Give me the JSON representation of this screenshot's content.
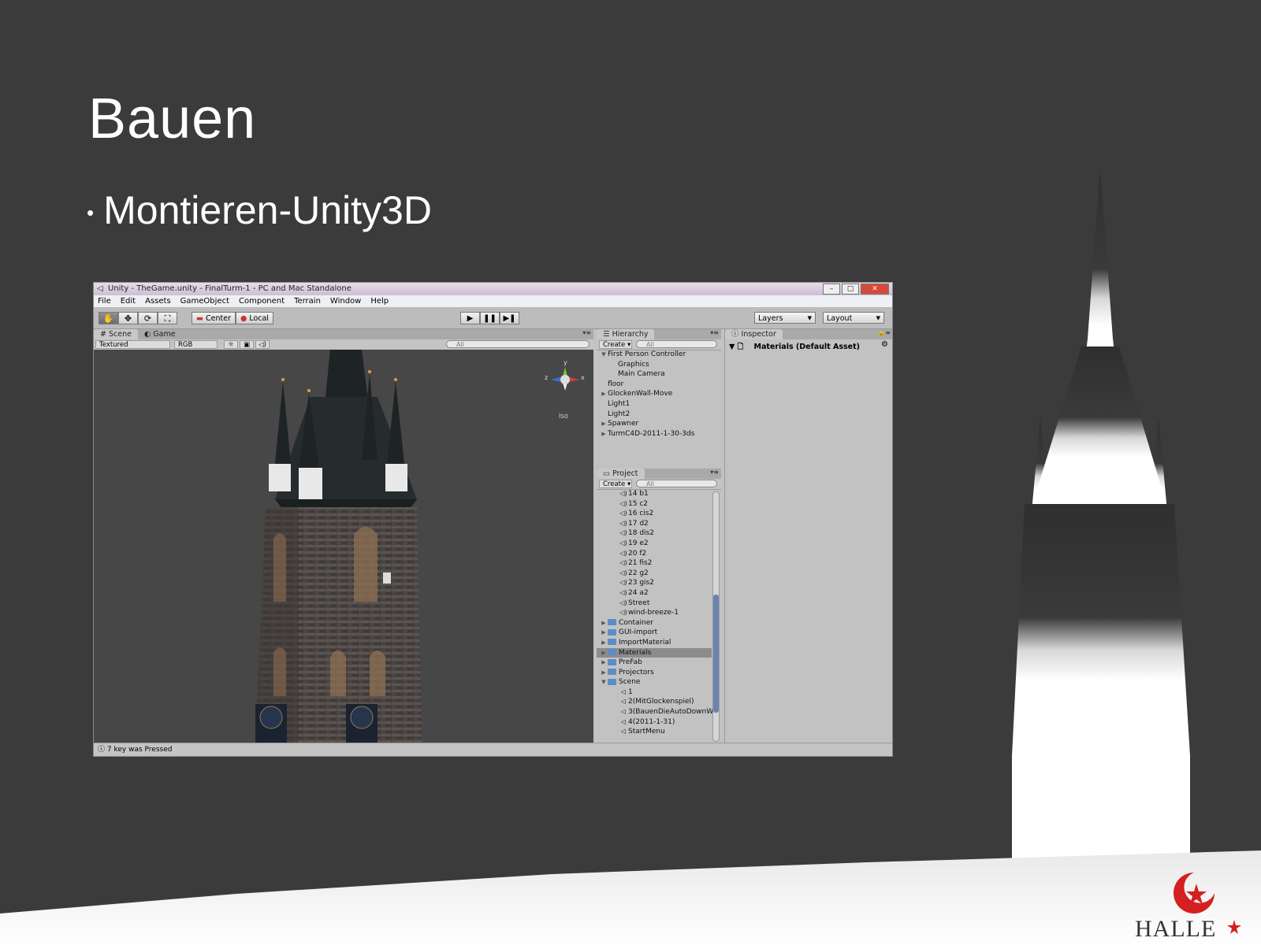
{
  "slide": {
    "title": "Bauen",
    "bullet": "Montieren-Unity3D",
    "logo_text": "HALLE"
  },
  "window": {
    "title": "Unity - TheGame.unity - FinalTurm-1 - PC and Mac Standalone",
    "menu": [
      "File",
      "Edit",
      "Assets",
      "GameObject",
      "Component",
      "Terrain",
      "Window",
      "Help"
    ],
    "toolbar": {
      "pivot_center": "Center",
      "pivot_local": "Local",
      "layers": "Layers",
      "layout": "Layout"
    },
    "scene": {
      "tab_scene": "Scene",
      "tab_game": "Game",
      "render_mode": "Textured",
      "color_mode": "RGB",
      "search_placeholder": "All",
      "gizmo_label": "Iso"
    },
    "hierarchy": {
      "tab": "Hierarchy",
      "create": "Create",
      "search_placeholder": "All",
      "items": [
        {
          "label": "First Person Controller",
          "expanded": true,
          "indent": 0
        },
        {
          "label": "Graphics",
          "indent": 1
        },
        {
          "label": "Main Camera",
          "indent": 1
        },
        {
          "label": "floor",
          "indent": 0
        },
        {
          "label": "GlockenWall-Move",
          "collapsed": true,
          "indent": 0
        },
        {
          "label": "Light1",
          "indent": 0
        },
        {
          "label": "Light2",
          "indent": 0
        },
        {
          "label": "Spawner",
          "collapsed": true,
          "indent": 0
        },
        {
          "label": "TurmC4D-2011-1-30-3ds",
          "collapsed": true,
          "indent": 0
        }
      ]
    },
    "project": {
      "tab": "Project",
      "create": "Create",
      "search_placeholder": "All",
      "items": [
        {
          "label": "14 b1",
          "type": "audio"
        },
        {
          "label": "15 c2",
          "type": "audio"
        },
        {
          "label": "16 cis2",
          "type": "audio"
        },
        {
          "label": "17 d2",
          "type": "audio"
        },
        {
          "label": "18 dis2",
          "type": "audio"
        },
        {
          "label": "19 e2",
          "type": "audio"
        },
        {
          "label": "20 f2",
          "type": "audio"
        },
        {
          "label": "21 fis2",
          "type": "audio"
        },
        {
          "label": "22 g2",
          "type": "audio"
        },
        {
          "label": "23 gis2",
          "type": "audio"
        },
        {
          "label": "24 a2",
          "type": "audio"
        },
        {
          "label": "Street",
          "type": "audio"
        },
        {
          "label": "wind-breeze-1",
          "type": "audio"
        },
        {
          "label": "Container",
          "type": "prefab-folder"
        },
        {
          "label": "GUI-import",
          "type": "folder"
        },
        {
          "label": "ImportMaterial",
          "type": "folder"
        },
        {
          "label": "Materials",
          "type": "folder",
          "selected": true
        },
        {
          "label": "PreFab",
          "type": "folder"
        },
        {
          "label": "Projectors",
          "type": "folder"
        },
        {
          "label": "Scene",
          "type": "folder",
          "expanded": true
        },
        {
          "label": "1",
          "type": "scene"
        },
        {
          "label": "2(MitGlockenspiel)",
          "type": "scene"
        },
        {
          "label": "3(BauenDieAutoDownW",
          "type": "scene"
        },
        {
          "label": "4(2011-1-31)",
          "type": "scene"
        },
        {
          "label": "StartMenu",
          "type": "scene"
        }
      ]
    },
    "inspector": {
      "tab": "Inspector",
      "asset": "Materials (Default Asset)"
    },
    "status": "7 key was Pressed"
  }
}
